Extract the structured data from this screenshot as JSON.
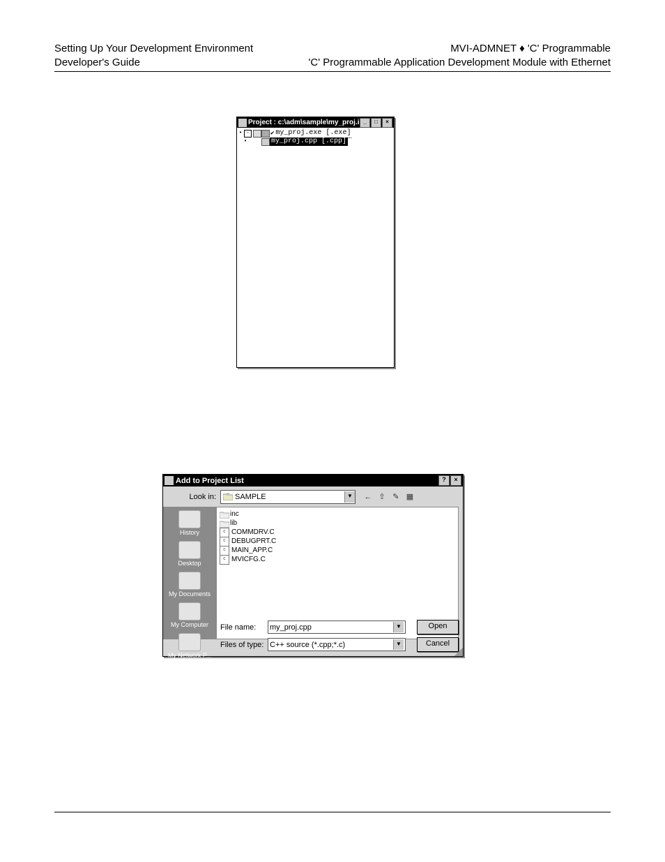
{
  "header": {
    "left_line1": "Setting Up Your Development Environment",
    "left_line2": "Developer's Guide",
    "right_line1": "MVI-ADMNET ♦ 'C' Programmable",
    "right_line2": "'C' Programmable Application Development Module with Ethernet"
  },
  "project_window": {
    "title": "Project : c:\\adm\\sample\\my_proj.ide",
    "nodes": {
      "root_label": "my_proj.exe [.exe]",
      "child_label": "my_proj.cpp [.cpp]"
    },
    "win_buttons": {
      "minimize": "_",
      "maximize": "□",
      "close": "×"
    }
  },
  "dialog": {
    "title": "Add to Project List",
    "help": "?",
    "close": "×",
    "lookin_label": "Look in:",
    "lookin_value": "SAMPLE",
    "toolbar": {
      "back": "←",
      "up": "⇧",
      "newfolder": "✎",
      "views": "▦"
    },
    "places": {
      "history": "History",
      "desktop": "Desktop",
      "mydocs": "My Documents",
      "mycomp": "My Computer",
      "mynet": "My Network P..."
    },
    "files": {
      "folder_inc": "inc",
      "folder_lib": "lib",
      "f1": "COMMDRV.C",
      "f2": "DEBUGPRT.C",
      "f3": "MAIN_APP.C",
      "f4": "MVICFG.C"
    },
    "filename_label": "File name:",
    "filename_value": "my_proj.cpp",
    "filetype_label": "Files of type:",
    "filetype_value": "C++ source (*.cpp;*.c)",
    "open_button": "Open",
    "cancel_button": "Cancel"
  }
}
